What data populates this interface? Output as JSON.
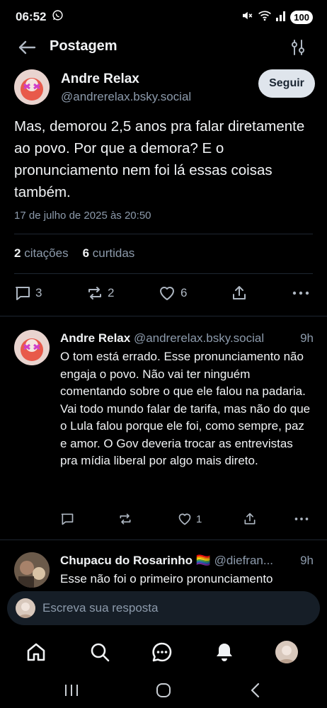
{
  "status_bar": {
    "time": "06:52",
    "battery": "100"
  },
  "header": {
    "title": "Postagem"
  },
  "post": {
    "author_name": "Andre Relax",
    "author_handle": "@andrerelax.bsky.social",
    "follow_label": "Seguir",
    "text": "Mas, demorou 2,5 anos pra falar diretamente ao povo. Por que a demora? E o pronunciamento nem foi lá essas coisas também.",
    "date": "17 de julho de 2025 às 20:50",
    "quotes_count": "2",
    "quotes_label": "citações",
    "likes_count": "6",
    "likes_label": "curtidas",
    "reply_count": "3",
    "repost_count": "2",
    "like_count": "6"
  },
  "replies": [
    {
      "name": "Andre Relax",
      "handle": "@andrerelax.bsky.social",
      "time": "9h",
      "text": "O tom está errado. Esse pronunciamento não engaja o povo. Não vai ter ninguém comentando sobre o que ele falou na padaria. Vai todo mundo falar de tarifa, mas não do que o Lula falou porque ele foi, como sempre, paz e amor. O Gov deveria trocar as entrevistas pra mídia liberal por algo mais direto.",
      "like_count": "1"
    },
    {
      "name": "Chupacu do Rosarinho 🏳️‍🌈",
      "handle": "@diefran...",
      "time": "9h",
      "text": "Esse não foi o primeiro pronunciamento"
    }
  ],
  "compose": {
    "placeholder": "Escreva sua resposta"
  },
  "colors": {
    "accent": "#1083fe",
    "background": "#000000",
    "muted": "#8c9aab"
  }
}
